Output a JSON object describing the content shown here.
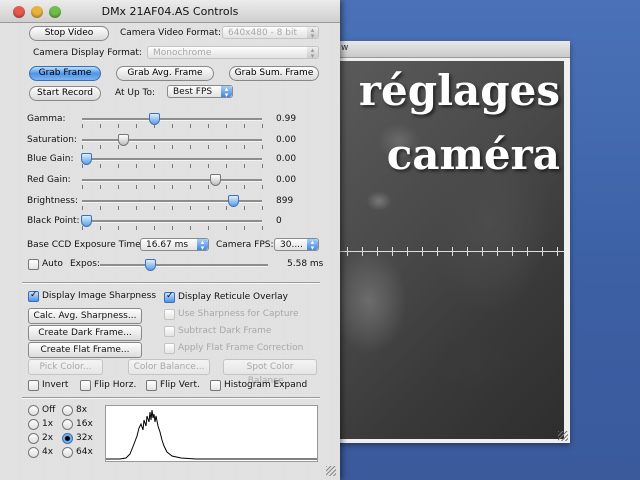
{
  "overlay": {
    "line1": "réglages",
    "line2": "caméra"
  },
  "moon_window": {
    "title_fragment": "w"
  },
  "panel": {
    "title": "DMx 21AF04.AS Controls",
    "stop_video": "Stop Video",
    "camera_video_format_label": "Camera Video Format:",
    "camera_video_format_value": "640x480 - 8 bit",
    "camera_display_format_label": "Camera Display Format:",
    "camera_display_format_value": "Monochrome",
    "grab_frame": "Grab Frame",
    "grab_avg_frame": "Grab Avg. Frame",
    "grab_sum_frame": "Grab Sum. Frame",
    "start_record": "Start Record",
    "at_up_to_label": "At Up To:",
    "at_up_to_value": "Best FPS",
    "sliders": [
      {
        "label": "Gamma:",
        "value": "0.99",
        "position": 0.4
      },
      {
        "label": "Saturation:",
        "value": "0.00",
        "position": 0.23
      },
      {
        "label": "Blue Gain:",
        "value": "0.00",
        "position": 0.02
      },
      {
        "label": "Red Gain:",
        "value": "0.00",
        "position": 0.74
      },
      {
        "label": "Brightness:",
        "value": "899",
        "position": 0.84
      },
      {
        "label": "Black Point:",
        "value": "0",
        "position": 0.02
      }
    ],
    "exposure_label": "Base CCD Exposure Time:",
    "exposure_value": "16.67 ms",
    "camera_fps_label": "Camera FPS:",
    "camera_fps_value": "30....",
    "auto_label": "Auto",
    "expos_label": "Expos:",
    "expos_value": "5.58 ms",
    "expos_position": 0.3,
    "display_sharpness": "Display Image Sharpness",
    "display_reticule": "Display Reticule Overlay",
    "calc_avg_sharpness": "Calc. Avg. Sharpness...",
    "use_sharpness": "Use Sharpness for Capture",
    "create_dark_frame": "Create Dark Frame...",
    "subtract_dark_frame": "Subtract Dark Frame",
    "create_flat_frame": "Create Flat Frame...",
    "apply_flat_frame": "Apply Flat Frame Correction",
    "pick_color": "Pick Color...",
    "color_balance": "Color Balance...",
    "spot_color_balance": "Spot Color Balance...",
    "invert": "Invert",
    "flip_horz": "Flip Horz.",
    "flip_vert": "Flip Vert.",
    "histogram_expand": "Histogram Expand",
    "zoom_options": [
      "Off",
      "1x",
      "2x",
      "4x",
      "8x",
      "16x",
      "32x",
      "64x"
    ],
    "zoom_selected": "32x"
  }
}
